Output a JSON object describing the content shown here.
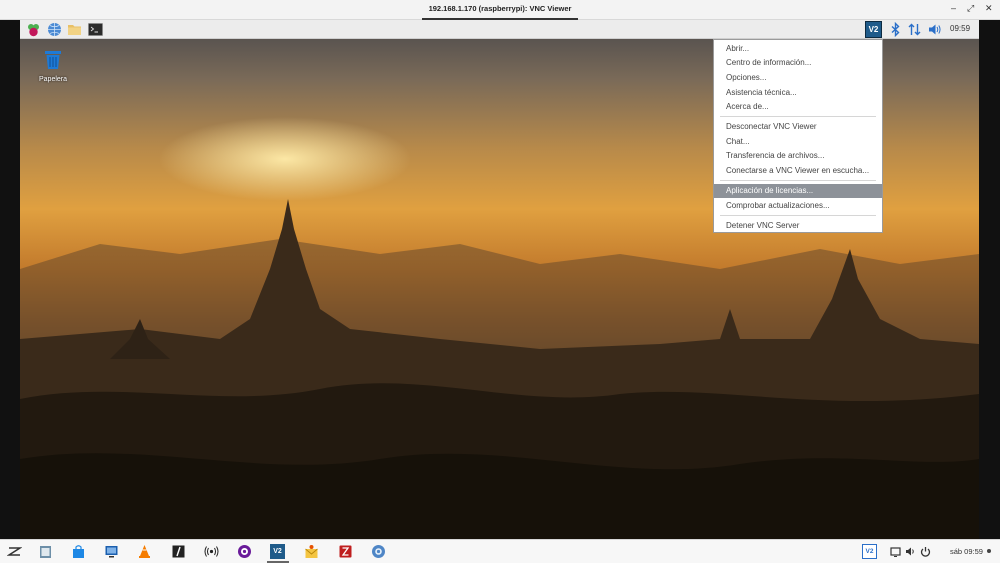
{
  "window": {
    "title": "192.168.1.170 (raspberrypi): VNC Viewer",
    "minimize": "–",
    "restore": "⤢",
    "close": "✕"
  },
  "remote": {
    "panel": {
      "clock": "09:59",
      "vnc_tray_label": "V2"
    },
    "desktop": {
      "trash_label": "Papelera"
    },
    "menu": {
      "items": [
        "Abrir...",
        "Centro de información...",
        "Opciones...",
        "Asistencia técnica...",
        "Acerca de...",
        "Desconectar VNC Viewer",
        "Chat...",
        "Transferencia de archivos...",
        "Conectarse a VNC Viewer en escucha...",
        "Aplicación de licencias...",
        "Comprobar actualizaciones...",
        "Detener VNC Server"
      ],
      "selected": "Aplicación de licencias..."
    }
  },
  "taskbar": {
    "clock": "sáb 09:59",
    "apps": [
      "zorin-menu-icon",
      "files-icon",
      "store-icon",
      "remote-desktop-icon",
      "vlc-icon",
      "editor-icon",
      "audio-icon",
      "media-player-icon",
      "vnc-viewer-icon",
      "mail-icon",
      "filezilla-icon",
      "browser-icon"
    ],
    "vnc_label": "V2"
  }
}
